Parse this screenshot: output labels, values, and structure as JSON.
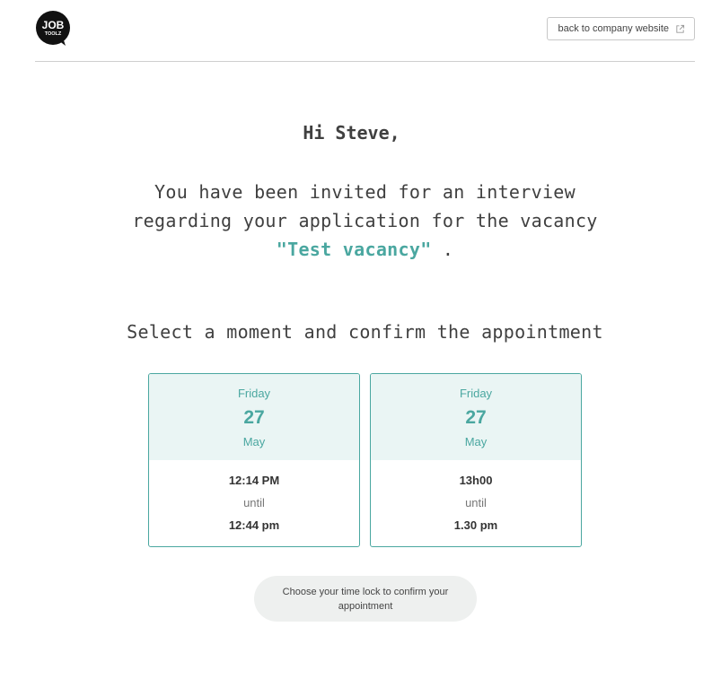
{
  "header": {
    "logo_text_top": "JOB",
    "logo_text_bottom": "TOOLZ",
    "back_label": "back to company website"
  },
  "main": {
    "greeting": "Hi Steve,",
    "invite_text": "You have been invited for an interview regarding your application for the vacancy",
    "vacancy": "\"Test vacancy\"",
    "invite_end": ".",
    "select_title": "Select a moment and confirm the appointment"
  },
  "slots": [
    {
      "day": "Friday",
      "date": "27",
      "month": "May",
      "from": "12:14 PM",
      "until": "until",
      "to": "12:44 pm"
    },
    {
      "day": "Friday",
      "date": "27",
      "month": "May",
      "from": "13h00",
      "until": "until",
      "to": "1.30 pm"
    }
  ],
  "confirm": {
    "label": "Choose your time lock to confirm your appointment"
  },
  "colors": {
    "accent": "#4aa7a0",
    "slot_header_bg": "#eaf5f4",
    "confirm_bg": "#eef0ef"
  }
}
